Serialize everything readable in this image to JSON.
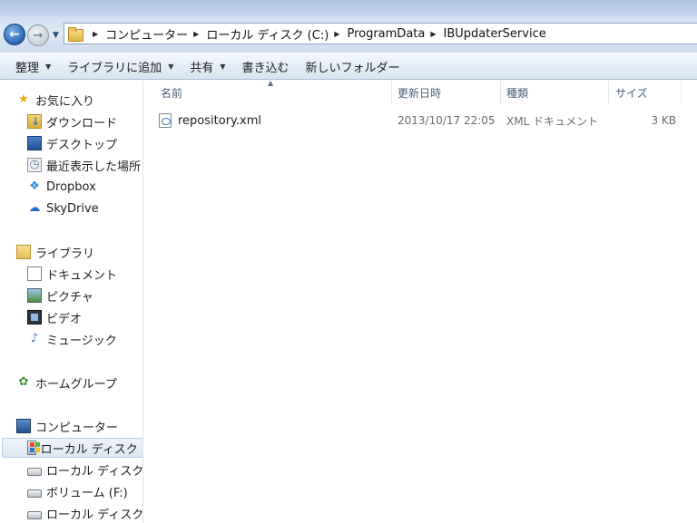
{
  "address_bar": {
    "breadcrumbs": [
      "コンピューター",
      "ローカル ディスク (C:)",
      "ProgramData",
      "IBUpdaterService"
    ]
  },
  "command_bar": {
    "organize": "整理",
    "include_in_library": "ライブラリに追加",
    "share_with": "共有",
    "burn": "書き込む",
    "new_folder": "新しいフォルダー"
  },
  "nav_pane": {
    "favorites": {
      "label": "お気に入り",
      "items": [
        "ダウンロード",
        "デスクトップ",
        "最近表示した場所",
        "Dropbox",
        "SkyDrive"
      ]
    },
    "libraries": {
      "label": "ライブラリ",
      "items": [
        "ドキュメント",
        "ピクチャ",
        "ビデオ",
        "ミュージック"
      ]
    },
    "homegroup": {
      "label": "ホームグループ"
    },
    "computer": {
      "label": "コンピューター",
      "items": [
        "ローカル ディスク (",
        "ローカル ディスク (",
        "ボリューム (F:)",
        "ローカル ディスク ("
      ],
      "selected_index": 0
    }
  },
  "file_list": {
    "columns": [
      "名前",
      "更新日時",
      "種類",
      "サイズ"
    ],
    "rows": [
      {
        "name": "repository.xml",
        "modified": "2013/10/17 22:05",
        "type": "XML ドキュメント",
        "size": "3 KB",
        "icon": "xml-file-icon"
      }
    ]
  },
  "colors": {
    "accent": "#2a63b4",
    "header_text": "#4c607a",
    "selection": "#dde7f2"
  }
}
